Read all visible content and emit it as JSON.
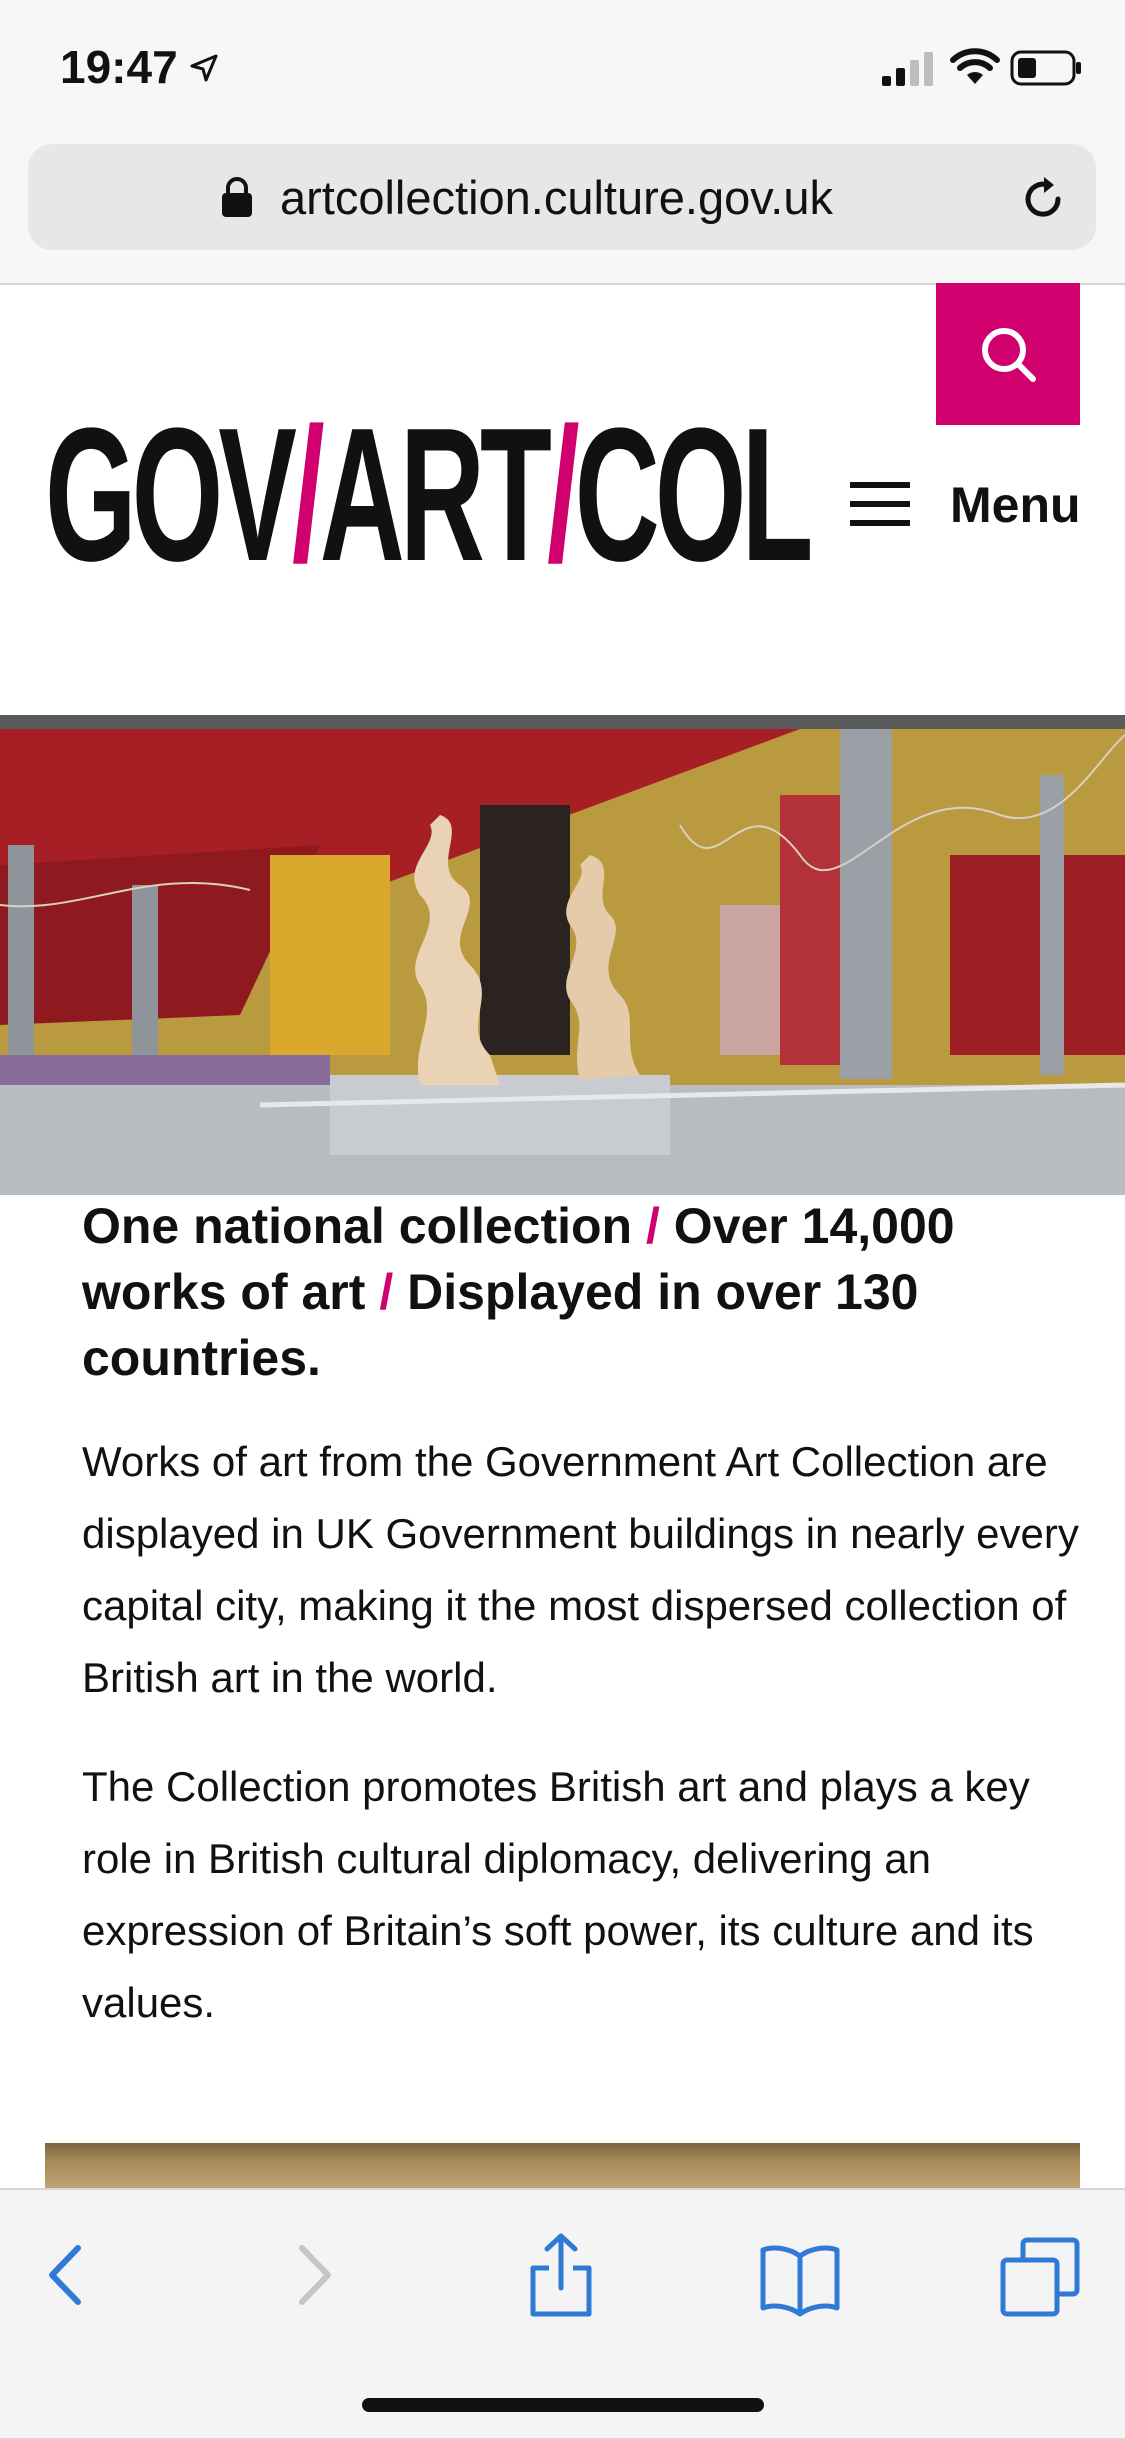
{
  "status_bar": {
    "time": "19:47",
    "icons": [
      "location-arrow-icon",
      "cellular-signal-icon",
      "wifi-icon",
      "battery-icon"
    ]
  },
  "browser": {
    "url": "artcollection.culture.gov.uk",
    "icons": [
      "lock-icon",
      "reload-icon"
    ]
  },
  "site_header": {
    "logo": {
      "part1": "GOV",
      "part2": "ART",
      "part3": "COL",
      "separator": "/"
    },
    "menu_label": "Menu",
    "accent_color": "#d0006f",
    "icons": [
      "search-icon",
      "hamburger-icon"
    ]
  },
  "intro": {
    "headline": {
      "part1": "One national collection",
      "part2": "Over 14,000 works of art",
      "part3": "Displayed in over 130 countries.",
      "separator": "/"
    },
    "paragraph1": "Works of art from the Government Art Collection are displayed in UK Government buildings in nearly every capital city, making it the most dispersed collection of British art in the world.",
    "paragraph2": "The Collection promotes British art and plays a key role in British cultural diplomacy, delivering an expression of Britain’s soft power, its culture and its values."
  },
  "toolbar": {
    "icons": [
      "back-icon",
      "forward-icon",
      "share-icon",
      "bookmarks-icon",
      "tabs-icon"
    ],
    "active_color": "#2f7ad6",
    "disabled_color": "#c6c6c8"
  }
}
